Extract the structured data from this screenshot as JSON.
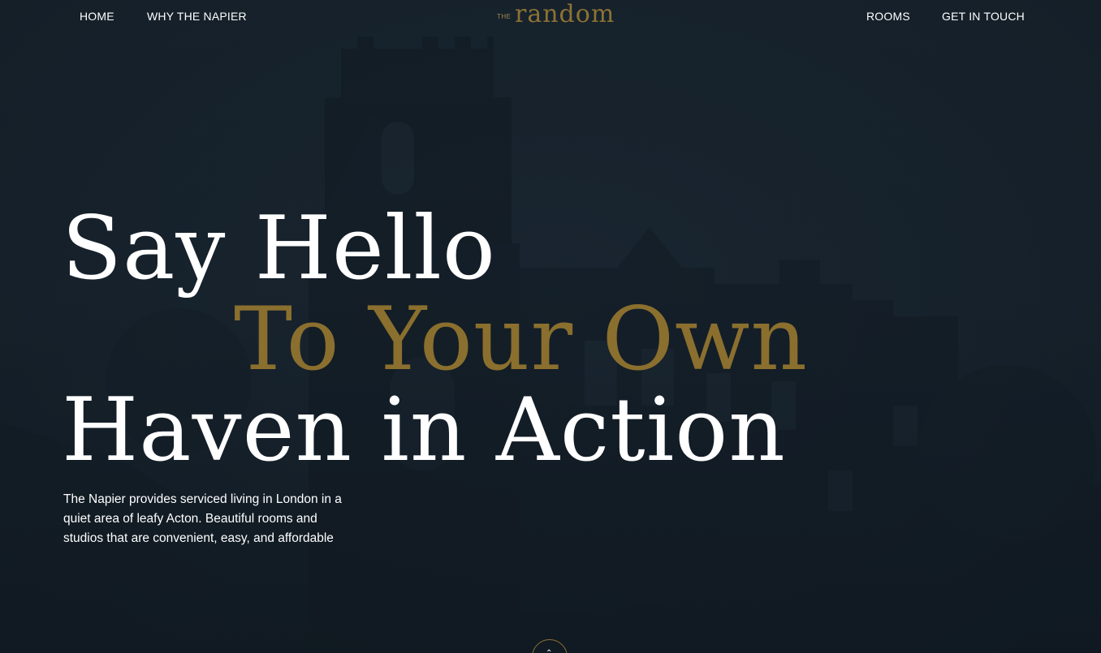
{
  "nav": {
    "home": "HOME",
    "why": "WHY THE NAPIER",
    "rooms": "ROOMS",
    "contact": "GET IN TOUCH"
  },
  "logo": {
    "prefix": "THE",
    "name": "random"
  },
  "hero": {
    "line1": "Say Hello",
    "line2": "To Your Own",
    "line3": "Haven in Action",
    "description": "The Napier provides serviced living in London in a quiet area of leafy Acton.  Beautiful rooms and studios that are convenient, easy, and affordable"
  },
  "scroll": {
    "icon": "chevron-down-icon",
    "glyph": "⌃"
  },
  "colors": {
    "background": "#17222c",
    "accent_gold": "#8a6f2e",
    "text": "#ffffff"
  }
}
